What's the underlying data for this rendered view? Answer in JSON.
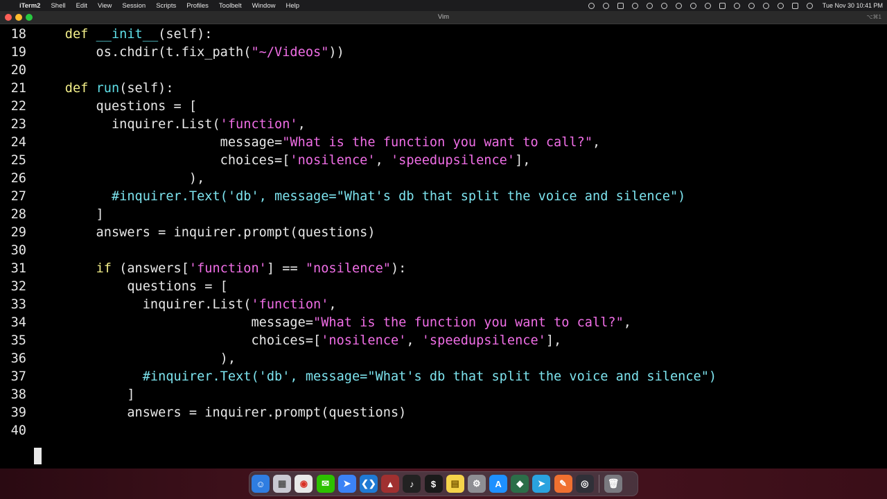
{
  "menubar": {
    "app_name": "iTerm2",
    "items": [
      "Shell",
      "Edit",
      "View",
      "Session",
      "Scripts",
      "Profiles",
      "Toolbelt",
      "Window",
      "Help"
    ],
    "clock": "Tue Nov 30  10:41 PM"
  },
  "window": {
    "title": "Vim",
    "shortcut": "⌥⌘1"
  },
  "editor": {
    "lines": [
      {
        "n": "18",
        "tokens": [
          [
            "",
            "    "
          ],
          [
            "kw",
            "def"
          ],
          [
            "",
            " "
          ],
          [
            "fn",
            "__init__"
          ],
          [
            "",
            "(self):"
          ]
        ]
      },
      {
        "n": "19",
        "tokens": [
          [
            "",
            "        os.chdir(t.fix_path("
          ],
          [
            "str",
            "\"~/Videos\""
          ],
          [
            "",
            "))"
          ]
        ]
      },
      {
        "n": "20",
        "tokens": []
      },
      {
        "n": "21",
        "tokens": [
          [
            "",
            "    "
          ],
          [
            "kw",
            "def"
          ],
          [
            "",
            " "
          ],
          [
            "fn",
            "run"
          ],
          [
            "",
            "(self):"
          ]
        ]
      },
      {
        "n": "22",
        "tokens": [
          [
            "",
            "        questions = ["
          ]
        ]
      },
      {
        "n": "23",
        "tokens": [
          [
            "",
            "          inquirer.List("
          ],
          [
            "str",
            "'function'"
          ],
          [
            "",
            ","
          ]
        ]
      },
      {
        "n": "24",
        "tokens": [
          [
            "",
            "                        message="
          ],
          [
            "str",
            "\"What is the function you want to call?\""
          ],
          [
            "",
            ","
          ]
        ]
      },
      {
        "n": "25",
        "tokens": [
          [
            "",
            "                        choices=["
          ],
          [
            "str",
            "'nosilence'"
          ],
          [
            "",
            ", "
          ],
          [
            "str",
            "'speedupsilence'"
          ],
          [
            "",
            "],"
          ]
        ]
      },
      {
        "n": "26",
        "tokens": [
          [
            "",
            "                    ),"
          ]
        ]
      },
      {
        "n": "27",
        "tokens": [
          [
            "",
            "          "
          ],
          [
            "cm",
            "#inquirer.Text('db', message=\"What's db that split the voice and silence\")"
          ]
        ]
      },
      {
        "n": "28",
        "tokens": [
          [
            "",
            "        ]"
          ]
        ]
      },
      {
        "n": "29",
        "tokens": [
          [
            "",
            "        answers = inquirer.prompt(questions)"
          ]
        ]
      },
      {
        "n": "30",
        "tokens": []
      },
      {
        "n": "31",
        "tokens": [
          [
            "",
            "        "
          ],
          [
            "kw",
            "if"
          ],
          [
            "",
            " (answers["
          ],
          [
            "str",
            "'function'"
          ],
          [
            "",
            "] == "
          ],
          [
            "str",
            "\"nosilence\""
          ],
          [
            "",
            "):"
          ]
        ]
      },
      {
        "n": "32",
        "tokens": [
          [
            "",
            "            questions = ["
          ]
        ]
      },
      {
        "n": "33",
        "tokens": [
          [
            "",
            "              inquirer.List("
          ],
          [
            "str",
            "'function'"
          ],
          [
            "",
            ","
          ]
        ]
      },
      {
        "n": "34",
        "tokens": [
          [
            "",
            "                            message="
          ],
          [
            "str",
            "\"What is the function you want to call?\""
          ],
          [
            "",
            ","
          ]
        ]
      },
      {
        "n": "35",
        "tokens": [
          [
            "",
            "                            choices=["
          ],
          [
            "str",
            "'nosilence'"
          ],
          [
            "",
            ", "
          ],
          [
            "str",
            "'speedupsilence'"
          ],
          [
            "",
            "],"
          ]
        ]
      },
      {
        "n": "36",
        "tokens": [
          [
            "",
            "                        ),"
          ]
        ]
      },
      {
        "n": "37",
        "tokens": [
          [
            "",
            "              "
          ],
          [
            "cm",
            "#inquirer.Text('db', message=\"What's db that split the voice and silence\")"
          ]
        ]
      },
      {
        "n": "38",
        "tokens": [
          [
            "",
            "            ]"
          ]
        ]
      },
      {
        "n": "39",
        "tokens": [
          [
            "",
            "            answers = inquirer.prompt(questions)"
          ]
        ]
      },
      {
        "n": "40",
        "tokens": []
      }
    ]
  },
  "dock": {
    "apps": [
      {
        "name": "finder-icon",
        "color": "#2f7de1",
        "glyph": "☺"
      },
      {
        "name": "launchpad-icon",
        "color": "#c9c9d2",
        "glyph": "▦"
      },
      {
        "name": "chrome-icon",
        "color": "#e8e8e8",
        "glyph": "◉"
      },
      {
        "name": "wechat-icon",
        "color": "#2dc100",
        "glyph": "✉"
      },
      {
        "name": "papers-icon",
        "color": "#3b82f6",
        "glyph": "➤"
      },
      {
        "name": "vscode-icon",
        "color": "#1f7ad4",
        "glyph": "❮❯"
      },
      {
        "name": "sketchup-icon",
        "color": "#a03030",
        "glyph": "▲"
      },
      {
        "name": "piano-icon",
        "color": "#222222",
        "glyph": "♪"
      },
      {
        "name": "terminal-icon",
        "color": "#1a1a1a",
        "glyph": "$"
      },
      {
        "name": "notes-icon",
        "color": "#f5d34a",
        "glyph": "▤"
      },
      {
        "name": "system-preferences-icon",
        "color": "#8e8e93",
        "glyph": "⚙"
      },
      {
        "name": "app-store-icon",
        "color": "#1e90ff",
        "glyph": "A"
      },
      {
        "name": "sourcetree-icon",
        "color": "#2c6e49",
        "glyph": "◆"
      },
      {
        "name": "telegram-icon",
        "color": "#2aa3df",
        "glyph": "➤"
      },
      {
        "name": "pen-icon",
        "color": "#f07030",
        "glyph": "✎"
      },
      {
        "name": "obs-icon",
        "color": "#303038",
        "glyph": "◎"
      }
    ],
    "trash": {
      "name": "trash-icon",
      "color": "#7a7a80",
      "glyph": "🗑"
    }
  },
  "colors": {
    "keyword": "#f4f08a",
    "function": "#5fdfe8",
    "string": "#f06ee6",
    "comment": "#7de3ee",
    "text": "#e8e8e8",
    "background": "#000000"
  }
}
